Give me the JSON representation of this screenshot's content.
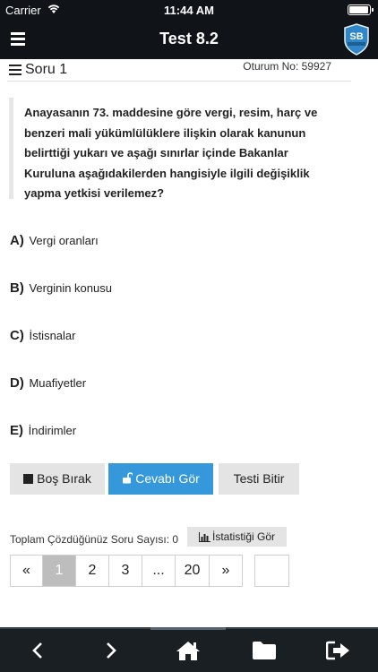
{
  "status_bar": {
    "carrier": "Carrier",
    "time": "11:44 AM"
  },
  "app_bar": {
    "title": "Test 8.2",
    "logo_text": "SB"
  },
  "question_header": {
    "label": "Soru 1",
    "session": "Oturum No: 59927"
  },
  "question": {
    "text_lines": [
      "Anayasanın 73. maddesine göre vergi, resim, harç ve",
      "benzeri mali yükümlülüklere ilişkin olarak kanunun",
      "belirttiği yukarı ve aşağı sınırlar içinde Bakanlar",
      "Kuruluna aşağıdakilerden hangisiyle ilgili değişiklik",
      "yapma yetkisi verilemez?"
    ]
  },
  "options": [
    {
      "letter": "A)",
      "text": "Vergi oranları"
    },
    {
      "letter": "B)",
      "text": "Verginin konusu"
    },
    {
      "letter": "C)",
      "text": "İstisnalar"
    },
    {
      "letter": "D)",
      "text": "Muafiyetler"
    },
    {
      "letter": "E)",
      "text": "İndirimler"
    }
  ],
  "actions": {
    "blank": "Boş Bırak",
    "show_answer": "Cevabı Gör",
    "finish": "Testi Bitir"
  },
  "stats": {
    "solved_label": "Toplam Çözdüğünüz Soru Sayısı: 0",
    "view_stats": "İstatistiği Gör"
  },
  "pagination": {
    "prev": "«",
    "pages": [
      "1",
      "2",
      "3",
      "...",
      "20"
    ],
    "next": "»",
    "active": "1"
  },
  "colors": {
    "primary": "#3498db",
    "bar": "#101418",
    "bottom_nav": "#1a1f23",
    "button_gray": "#e4e4e4",
    "active_page": "#bdbdbd"
  },
  "bottom_nav": {
    "icons": [
      "chevron-left-icon",
      "chevron-right-icon",
      "home-icon",
      "folder-icon",
      "logout-icon"
    ]
  }
}
